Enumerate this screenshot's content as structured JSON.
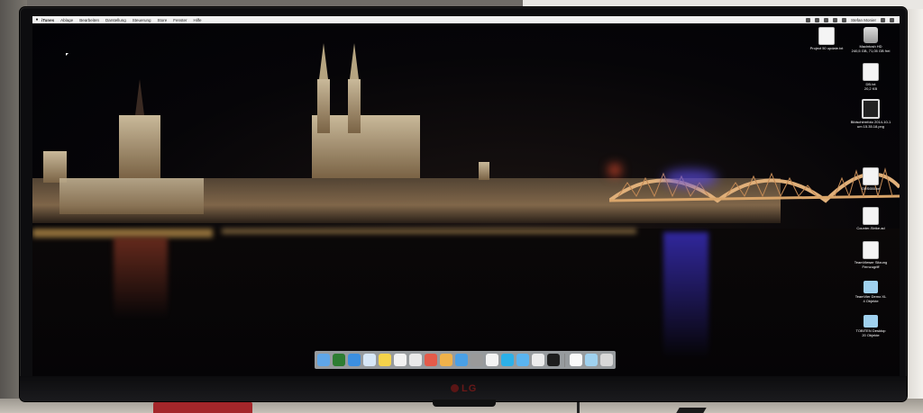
{
  "menubar": {
    "apple": "",
    "app_menu": "iTunes",
    "items": [
      "Ablage",
      "Bearbeiten",
      "Darstellung",
      "Steuerung",
      "Store",
      "Fenster",
      "Hilfe"
    ],
    "user": "Stefan Monier"
  },
  "desktop_icons": [
    {
      "label": "Project 50 update.txt",
      "kind": "doc"
    },
    {
      "label": "Macintosh HD\n240,5 GB, 71,05 GB frei",
      "kind": "drive"
    },
    {
      "label": "DB.txt\n20,2 KB",
      "kind": "doc"
    },
    {
      "label": "Bildschirmfoto 2014-10-1\num 15.35.18.png",
      "kind": "shot"
    },
    {
      "label": "GRS650.txt",
      "kind": "doc"
    },
    {
      "label": "Counter-Strike.ad",
      "kind": "doc"
    },
    {
      "label": "TeamViewer Sitzung\nFernzugriff",
      "kind": "doc"
    },
    {
      "label": "TeamVier Demo XL\n4 Objekte",
      "kind": "folder"
    },
    {
      "label": "TOBITEN Desktop\n20 Objekte",
      "kind": "folder"
    }
  ],
  "dock_apps": [
    {
      "icon": "finder-icon",
      "color": "#5fa6e8"
    },
    {
      "icon": "dashboard-icon",
      "color": "#2e7d32"
    },
    {
      "icon": "safari-icon",
      "color": "#3b8fe0"
    },
    {
      "icon": "mail-icon",
      "color": "#d7e7f7"
    },
    {
      "icon": "notes-icon",
      "color": "#f5d34a"
    },
    {
      "icon": "calendar-icon",
      "color": "#f2f2f2"
    },
    {
      "icon": "preview-icon",
      "color": "#e9e9e9"
    },
    {
      "icon": "itunes-icon",
      "color": "#e45b4a"
    },
    {
      "icon": "photos-icon",
      "color": "#f0b24a"
    },
    {
      "icon": "app-store-icon",
      "color": "#4aa0e6"
    },
    {
      "icon": "system-preferences-icon",
      "color": "#9a9a9a"
    },
    {
      "icon": "textedit-icon",
      "color": "#f4f4f4"
    },
    {
      "icon": "skype-icon",
      "color": "#2cb0e8"
    },
    {
      "icon": "teamviewer-icon",
      "color": "#5ab4f0"
    },
    {
      "icon": "xcode-icon",
      "color": "#ececec"
    },
    {
      "icon": "terminal-icon",
      "color": "#1e1e1e"
    },
    {
      "icon": "document-icon",
      "color": "#fafafa"
    },
    {
      "icon": "downloads-folder-icon",
      "color": "#9fd1ef"
    },
    {
      "icon": "trash-icon",
      "color": "#d8d8d8"
    }
  ],
  "monitor": {
    "brand": "LG"
  }
}
